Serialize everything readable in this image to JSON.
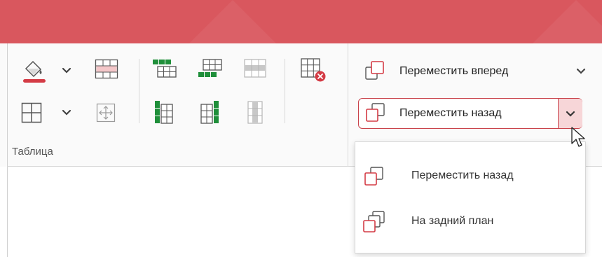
{
  "ribbon": {
    "table_group_label": "Таблица",
    "table_icons": [
      "fill-color-icon",
      "fill-dropdown-icon",
      "merge-cells-icon",
      "borders-icon",
      "borders-dropdown-icon",
      "move-table-icon",
      "insert-row-above-icon",
      "insert-row-below-icon",
      "delete-row-icon",
      "insert-column-left-icon",
      "insert-column-right-icon",
      "delete-column-icon",
      "delete-table-icon"
    ],
    "bring_forward_label": "Переместить вперед",
    "send_backward_label": "Переместить назад"
  },
  "dropdown": {
    "items": [
      {
        "label": "Переместить назад",
        "icon": "send-backward-icon"
      },
      {
        "label": "На задний план",
        "icon": "send-to-back-icon"
      }
    ]
  },
  "colors": {
    "titlebar": "#d9575e",
    "accent": "#c9434b",
    "green": "#1f8f3a",
    "split_hover": "#f7d6d8"
  }
}
